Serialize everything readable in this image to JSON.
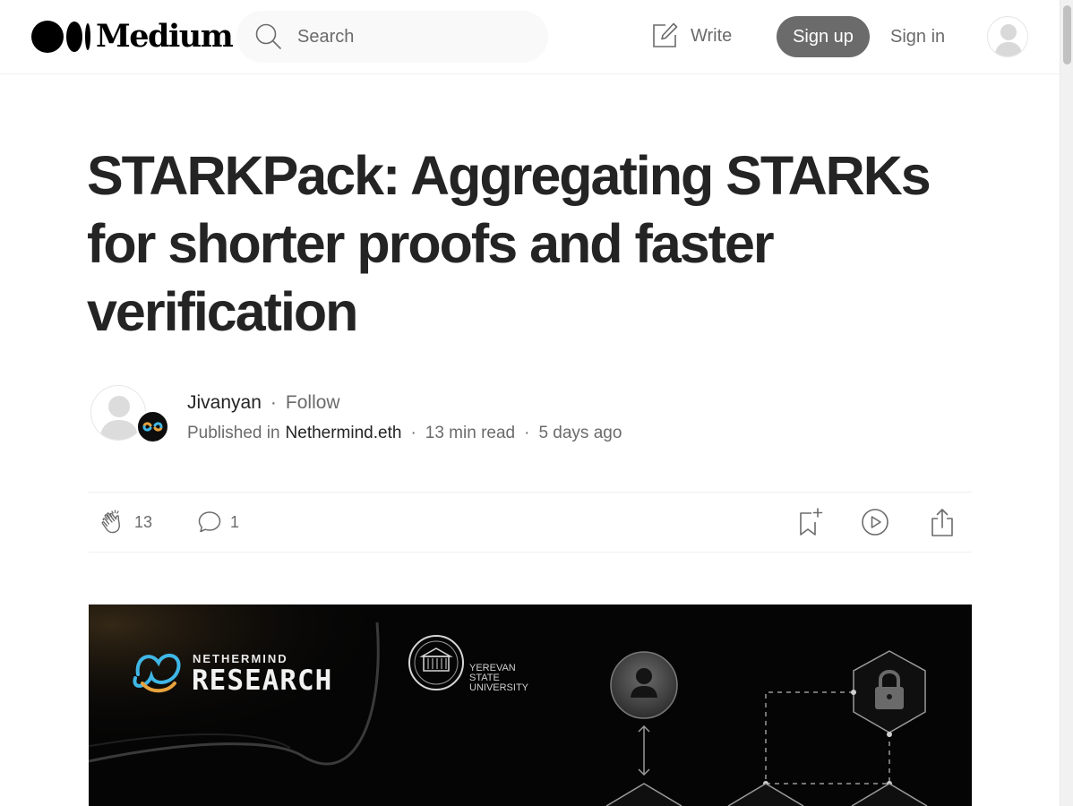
{
  "header": {
    "logo_text": "Medium",
    "search": {
      "placeholder": "Search",
      "value": ""
    },
    "write_label": "Write",
    "signup_label": "Sign up",
    "signin_label": "Sign in",
    "icons": {
      "search": "search-icon",
      "write": "write-icon",
      "avatar": "user-avatar-icon"
    }
  },
  "article": {
    "title": "STARKPack: Aggregating STARKs for shorter proofs and faster verification",
    "author": "Jivanyan",
    "follow_label": "Follow",
    "published_in_label": "Published in",
    "publication": "Nethermind.eth",
    "read_time": "13 min read",
    "posted": "5 days ago",
    "separator": "·"
  },
  "actions": {
    "claps": "13",
    "responses": "1",
    "icons": [
      "clap-icon",
      "response-icon",
      "bookmark-add-icon",
      "play-icon",
      "share-icon"
    ]
  },
  "hero": {
    "brand_small": "NETHERMIND",
    "brand_large": "RESEARCH",
    "university_lines": [
      "YEREVAN",
      "STATE",
      "UNIVERSITY"
    ]
  },
  "colors": {
    "text": "#242424",
    "muted": "#6b6b6b",
    "button_bg": "#6b6b6b",
    "search_bg": "#f9f9f9",
    "hero_bg": "#050505"
  }
}
